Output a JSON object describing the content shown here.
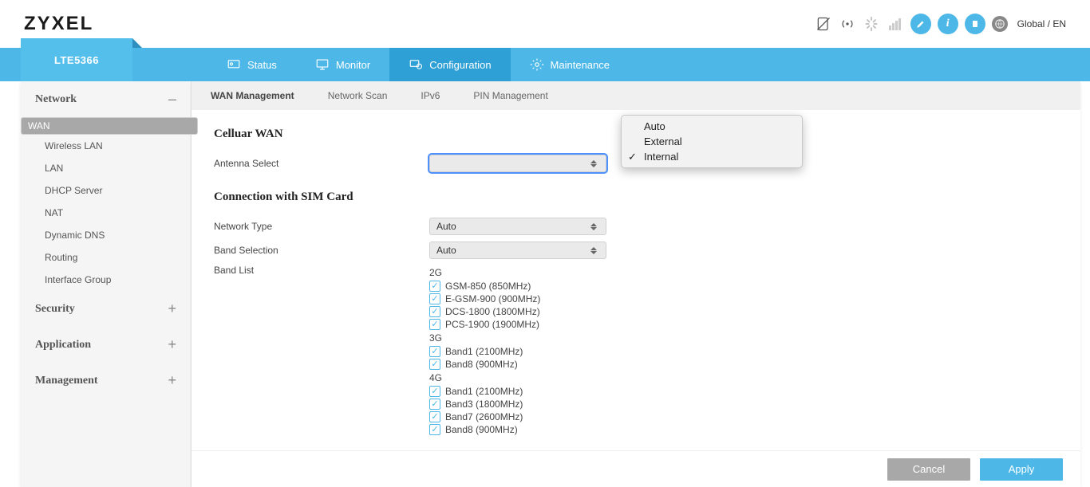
{
  "header": {
    "logo": "ZYXEL",
    "lang": "Global / EN"
  },
  "device": "LTE5366",
  "nav": {
    "status": "Status",
    "monitor": "Monitor",
    "configuration": "Configuration",
    "maintenance": "Maintenance"
  },
  "sidebar": {
    "network": {
      "title": "Network",
      "collapse": "–",
      "items": [
        "WAN",
        "Wireless LAN",
        "LAN",
        "DHCP Server",
        "NAT",
        "Dynamic DNS",
        "Routing",
        "Interface Group"
      ]
    },
    "security": {
      "title": "Security",
      "collapse": "+"
    },
    "application": {
      "title": "Application",
      "collapse": "+"
    },
    "management": {
      "title": "Management",
      "collapse": "+"
    }
  },
  "subtabs": {
    "wan_mgmt": "WAN Management",
    "net_scan": "Network Scan",
    "ipv6": "IPv6",
    "pin": "PIN Management"
  },
  "section": {
    "cellular": "Celluar WAN",
    "antenna_label": "Antenna Select",
    "connection": "Connection with SIM Card",
    "network_type_label": "Network Type",
    "network_type_value": "Auto",
    "band_sel_label": "Band Selection",
    "band_sel_value": "Auto",
    "band_list_label": "Band List"
  },
  "antenna_options": {
    "auto": "Auto",
    "external": "External",
    "internal": "Internal"
  },
  "bands": {
    "g2_label": "2G",
    "g2": [
      "GSM-850 (850MHz)",
      "E-GSM-900 (900MHz)",
      "DCS-1800 (1800MHz)",
      "PCS-1900 (1900MHz)"
    ],
    "g3_label": "3G",
    "g3": [
      "Band1 (2100MHz)",
      "Band8 (900MHz)"
    ],
    "g4_label": "4G",
    "g4": [
      "Band1 (2100MHz)",
      "Band3 (1800MHz)",
      "Band7 (2600MHz)",
      "Band8 (900MHz)"
    ]
  },
  "buttons": {
    "cancel": "Cancel",
    "apply": "Apply"
  }
}
